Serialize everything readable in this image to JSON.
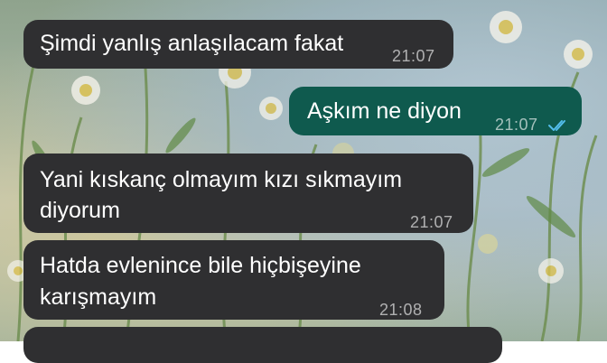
{
  "chat": {
    "messages": [
      {
        "direction": "incoming",
        "text": "Şimdi yanlış anlaşılacam fakat",
        "time": "21:07"
      },
      {
        "direction": "outgoing",
        "text": "Aşkım ne diyon",
        "time": "21:07",
        "status": "read"
      },
      {
        "direction": "incoming",
        "text_line1": "Yani kıskanç olmayım kızı sıkmayım",
        "text_line2": "diyorum",
        "time": "21:07"
      },
      {
        "direction": "incoming",
        "text_line1": "Hatda evlenince bile hiçbişeyine",
        "text_line2": "karışmayım",
        "time": "21:08"
      }
    ]
  },
  "colors": {
    "incoming_bubble": "#2f2f31",
    "outgoing_bubble": "#0f5a4e",
    "read_ticks": "#53bdeb"
  },
  "icons": {
    "read_receipt": "double-check-icon"
  }
}
